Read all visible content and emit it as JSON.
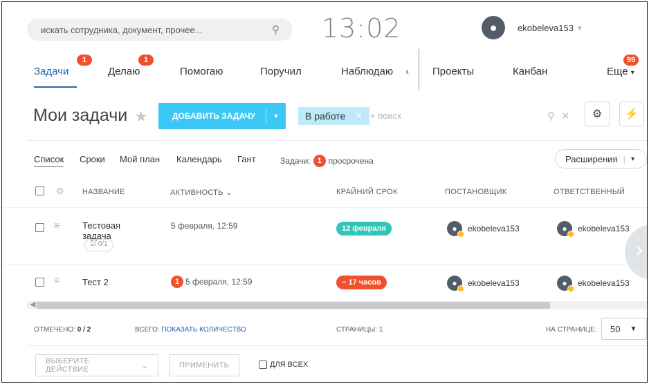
{
  "header": {
    "search_placeholder": "искать сотрудника, документ, прочее...",
    "clock": "13:02",
    "username": "ekobeleva153"
  },
  "tabs": [
    {
      "label": "Задачи",
      "badge": "1"
    },
    {
      "label": "Делаю",
      "badge": "1"
    },
    {
      "label": "Помогаю",
      "badge": ""
    },
    {
      "label": "Поручил",
      "badge": ""
    },
    {
      "label": "Наблюдаю",
      "badge": ""
    },
    {
      "label": "Проекты",
      "badge": ""
    },
    {
      "label": "Канбан",
      "badge": ""
    },
    {
      "label": "Еще",
      "badge": "99"
    }
  ],
  "toolbar": {
    "title": "Мои задачи",
    "add_button": "ДОБАВИТЬ ЗАДАЧУ",
    "filter_chip": "В работе",
    "search_hint": "+ поиск"
  },
  "views": {
    "items": [
      "Список",
      "Сроки",
      "Мой план",
      "Календарь",
      "Гант"
    ],
    "tasks_label": "Задачи:",
    "overdue_count": "1",
    "overdue_label": "просрочена",
    "extensions": "Расширения"
  },
  "table": {
    "columns": [
      "НАЗВАНИЕ",
      "АКТИВНОСТЬ",
      "КРАЙНИЙ СРОК",
      "ПОСТАНОВЩИК",
      "ОТВЕТСТВЕННЫЙ"
    ],
    "rows": [
      {
        "name": "Тестовая задача",
        "subtasks": "0/1",
        "activity": "5 февраля, 12:59",
        "activity_badge": "",
        "deadline": "12 февраля",
        "deadline_color": "#2fc6b7",
        "creator": "ekobeleva153",
        "responsible": "ekobeleva153"
      },
      {
        "name": "Тест 2",
        "subtasks": "",
        "activity": "5 февраля, 12:59",
        "activity_badge": "1",
        "deadline": "− 17 часов",
        "deadline_color": "#f0512c",
        "creator": "ekobeleva153",
        "responsible": "ekobeleva153"
      }
    ]
  },
  "footer": {
    "marked_label": "ОТМЕЧЕНО:",
    "marked_value": "0 / 2",
    "total_label": "ВСЕГО:",
    "total_link": "ПОКАЗАТЬ КОЛИЧЕСТВО",
    "pages_label": "СТРАНИЦЫ: 1",
    "per_page_label": "НА СТРАНИЦЕ:",
    "per_page_value": "50"
  },
  "actions": {
    "choose_action": "ВЫБЕРИТЕ ДЕЙСТВИЕ",
    "apply": "ПРИМЕНИТЬ",
    "for_all": "ДЛЯ ВСЕХ"
  },
  "colors": {
    "accent": "#2067b0",
    "add_button": "#3bc8f5",
    "badge": "#f0512c"
  }
}
